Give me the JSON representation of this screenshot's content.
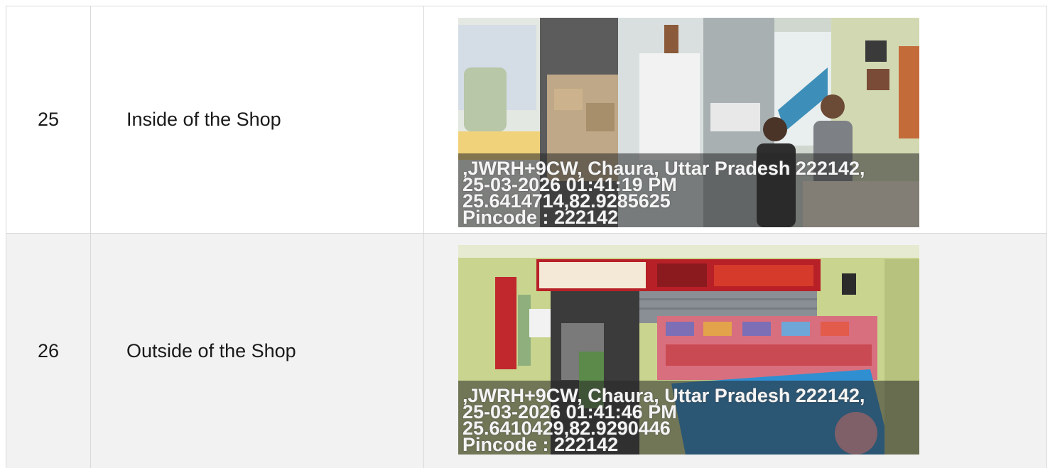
{
  "rows": [
    {
      "number": "25",
      "description": "Inside of the Shop",
      "photo": {
        "stamp_lines": [
          ",JWRH+9CW, Chaura, Uttar Pradesh 222142,",
          "25-03-2026 01:41:19 PM",
          "25.6414714,82.9285625",
          "Pincode : 222142"
        ],
        "colors": {
          "wall": "#cfd7cf",
          "boxes": "#bfa887",
          "floor": "#8b8b86",
          "sign": "#3d8fb9"
        }
      }
    },
    {
      "number": "26",
      "description": "Outside of the Shop",
      "photo": {
        "stamp_lines": [
          ",JWRH+9CW, Chaura, Uttar Pradesh 222142,",
          "25-03-2026 01:41:46 PM",
          "25.6410429,82.9290446",
          "Pincode : 222142"
        ],
        "colors": {
          "wall": "#c9d48f",
          "banner": "#b82027",
          "shutter": "#8a8f95",
          "display": "#2f8fd1"
        }
      }
    }
  ]
}
